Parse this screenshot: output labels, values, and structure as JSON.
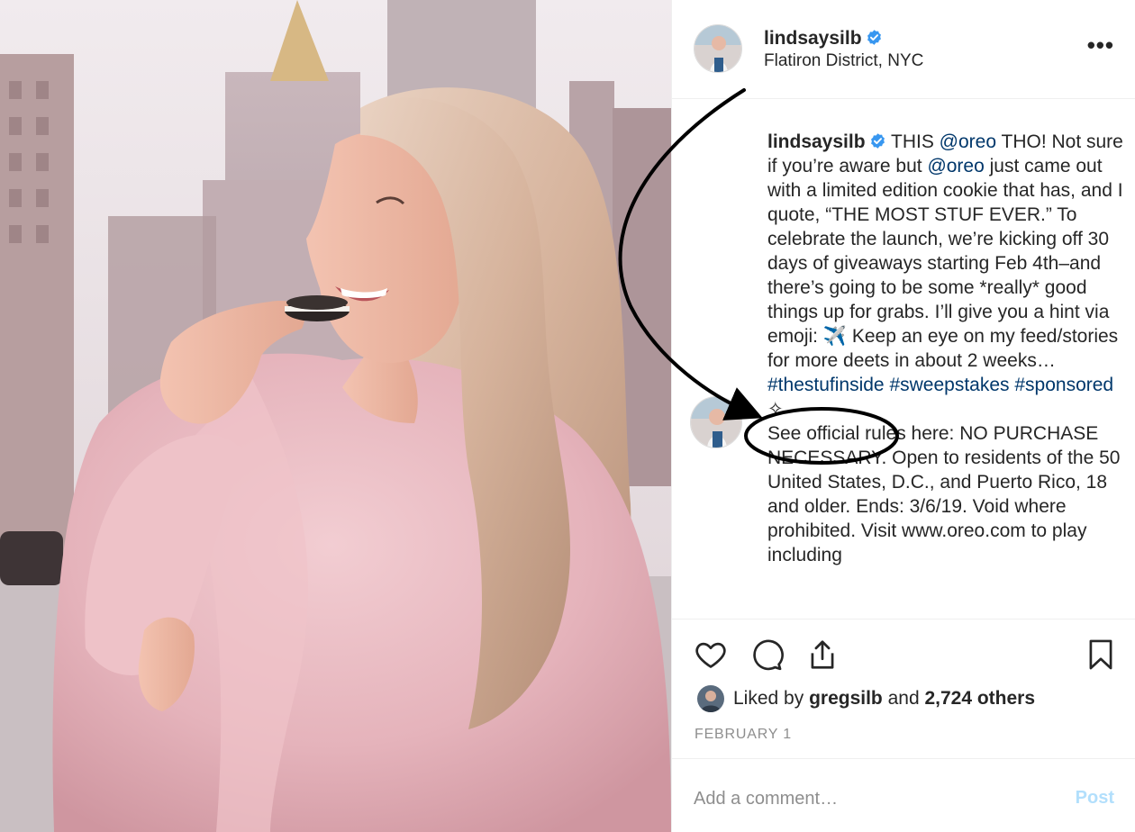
{
  "post": {
    "username": "lindsaysilb",
    "location": "Flatiron District, NYC",
    "more_icon": "more-options-icon",
    "verified_icon": "verified-badge-icon"
  },
  "caption": {
    "username": "lindsaysilb",
    "t1": " THIS ",
    "mention1": "@oreo",
    "t2": " THO! Not sure if you’re aware but ",
    "mention2": "@oreo",
    "t3": " just came out with a limited edition cookie that has, and I quote, “THE MOST STUF EVER.” To celebrate the launch, we’re kicking off 30 days of giveaways starting Feb 4th–and there’s going to be some *really* good things up for grabs. I’ll give you a hint via emoji: ✈️ Keep an eye on my feed/stories for more deets in about 2 weeks… ",
    "hashtag1": "#thestufinside",
    "hashtag2": "#sweepstakes",
    "hashtag3": "#sponsored",
    "sparkle": "✧",
    "rules": "See official rules here: NO PURCHASE NECESSARY.  Open to residents of the 50 United States, D.C., and Puerto Rico, 18 and older. Ends: 3/6/19. Void where prohibited. Visit www.oreo.com to play including"
  },
  "actions": {
    "like_icon": "heart-icon",
    "comment_icon": "comment-icon",
    "share_icon": "share-icon",
    "save_icon": "bookmark-icon"
  },
  "likes": {
    "prefix": "Liked by ",
    "user": "gregsilb",
    "middle": " and ",
    "count": "2,724 others"
  },
  "date": "FEBRUARY 1",
  "comment": {
    "placeholder": "Add a comment…",
    "post_label": "Post"
  },
  "colors": {
    "link": "#00376b",
    "verified": "#3897f0",
    "post_disabled": "#b2dffc",
    "muted": "#8e8e8e",
    "coat": "#e8b9c0",
    "annotation": "#000000"
  }
}
